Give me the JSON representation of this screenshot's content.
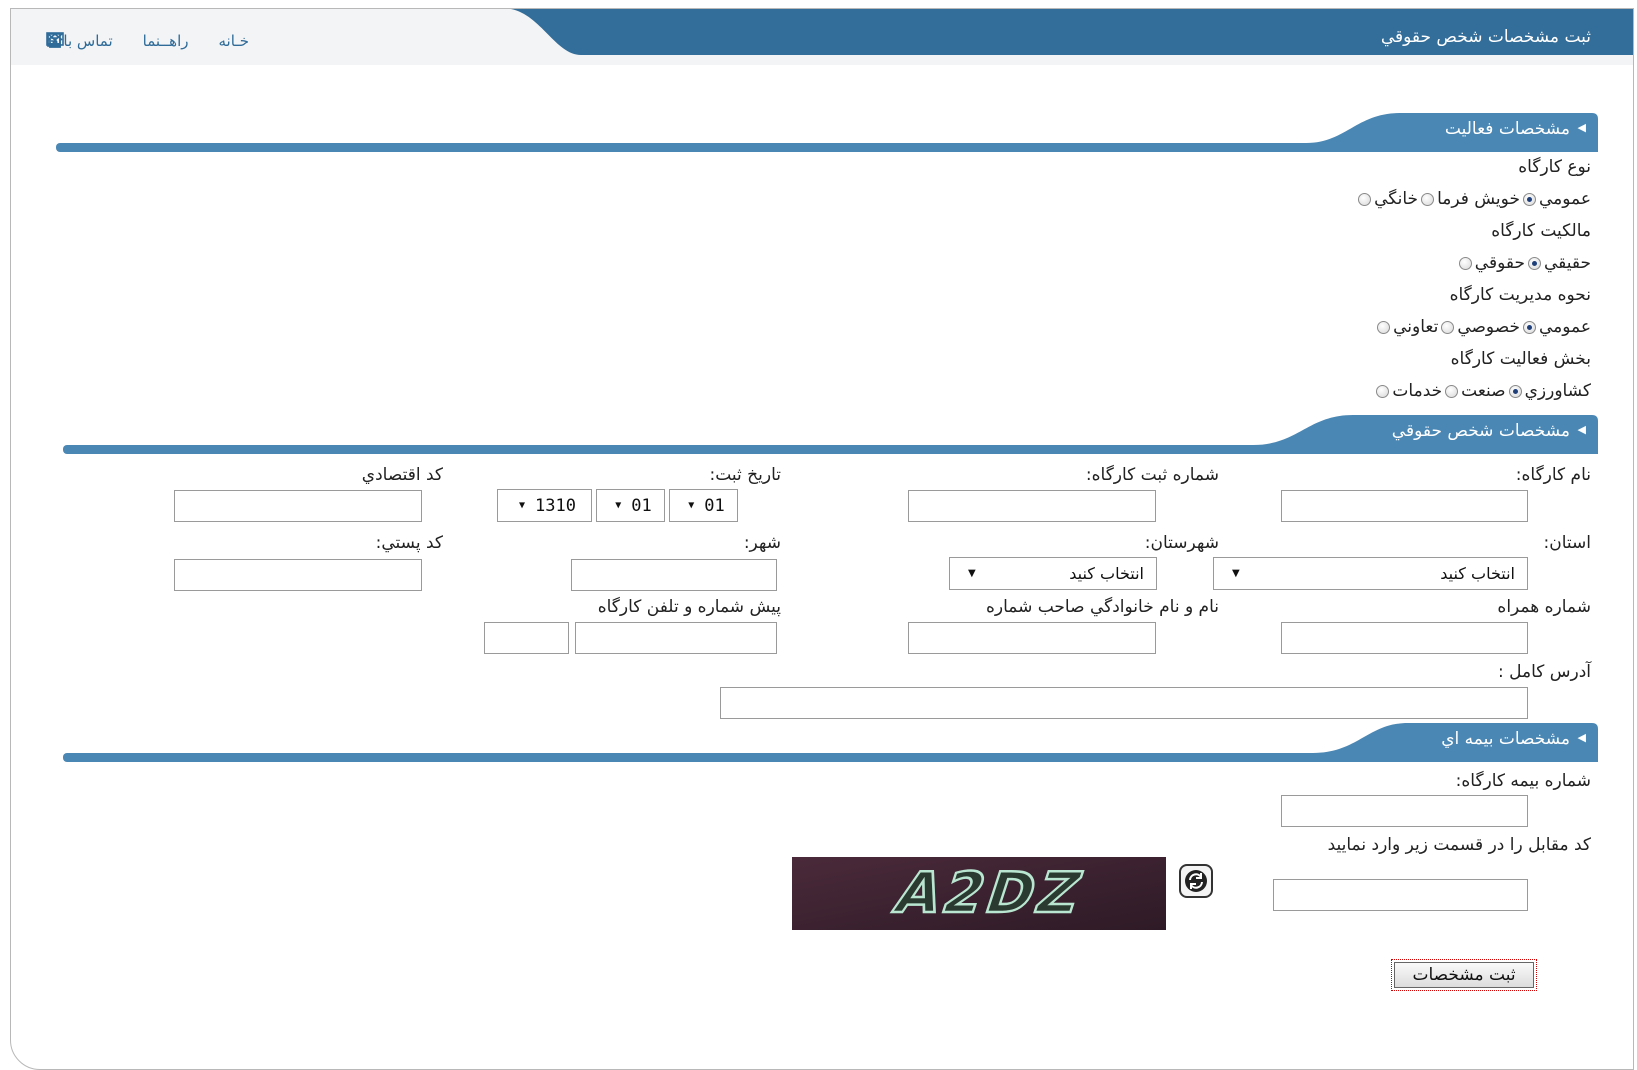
{
  "header": {
    "page_title": "ثبت مشخصات شخص حقوقي",
    "nav": {
      "home": "خـانه",
      "guide": "راهــنما",
      "contact": "تماس با ما"
    }
  },
  "colors": {
    "header_blue": "#336d99",
    "section_blue": "#4a87b4",
    "text": "#222222",
    "link": "#2f6b98"
  },
  "sections": {
    "activity": {
      "title": "مشخصات فعاليت",
      "workshop_type": {
        "label": "نوع كارگاه",
        "options": [
          "عمومي",
          "خويش فرما",
          "خانگي"
        ],
        "selected": "عمومي"
      },
      "ownership": {
        "label": "مالكيت كارگاه",
        "options": [
          "حقيقي",
          "حقوقي"
        ],
        "selected": "حقيقي"
      },
      "management": {
        "label": "نحوه مديريت كارگاه",
        "options": [
          "عمومي",
          "خصوصي",
          "تعاوني"
        ],
        "selected": "عمومي"
      },
      "sector": {
        "label": "بخش فعاليت كارگاه",
        "options": [
          "كشاورزي",
          "صنعت",
          "خدمات"
        ],
        "selected": "كشاورزي"
      }
    },
    "legal": {
      "title": "مشخصات شخص حقوقي",
      "workshop_name": {
        "label": "نام كارگاه:",
        "value": ""
      },
      "registration_no": {
        "label": "شماره ثبت كارگاه:",
        "value": ""
      },
      "registration_date": {
        "label": "تاريخ ثبت:",
        "day": "01",
        "month": "01",
        "year": "1310"
      },
      "economic_code": {
        "label": "كد اقتصادي",
        "value": ""
      },
      "province": {
        "label": "استان:",
        "selected": "انتخاب كنيد"
      },
      "county": {
        "label": "شهرستان:",
        "selected": "انتخاب كنيد"
      },
      "city": {
        "label": "شهر:",
        "value": ""
      },
      "postal_code": {
        "label": "كد پستي:",
        "value": ""
      },
      "mobile": {
        "label": "شماره همراه",
        "value": ""
      },
      "owner_name": {
        "label": "نام و نام خانوادگي صاحب شماره",
        "value": ""
      },
      "phone": {
        "label": "پيش شماره و تلفن كارگاه",
        "prefix": "",
        "number": ""
      },
      "address": {
        "label": "آدرس كامل :",
        "value": ""
      }
    },
    "insurance": {
      "title": "مشخصات بيمه اي",
      "insurance_no": {
        "label": "شماره بيمه كارگاه:",
        "value": ""
      },
      "captcha_instruction": "كد مقابل را در قسمت زير وارد نماييد",
      "captcha_text": "A2DZ",
      "captcha_input": ""
    }
  },
  "submit_label": "ثبت مشخصات"
}
